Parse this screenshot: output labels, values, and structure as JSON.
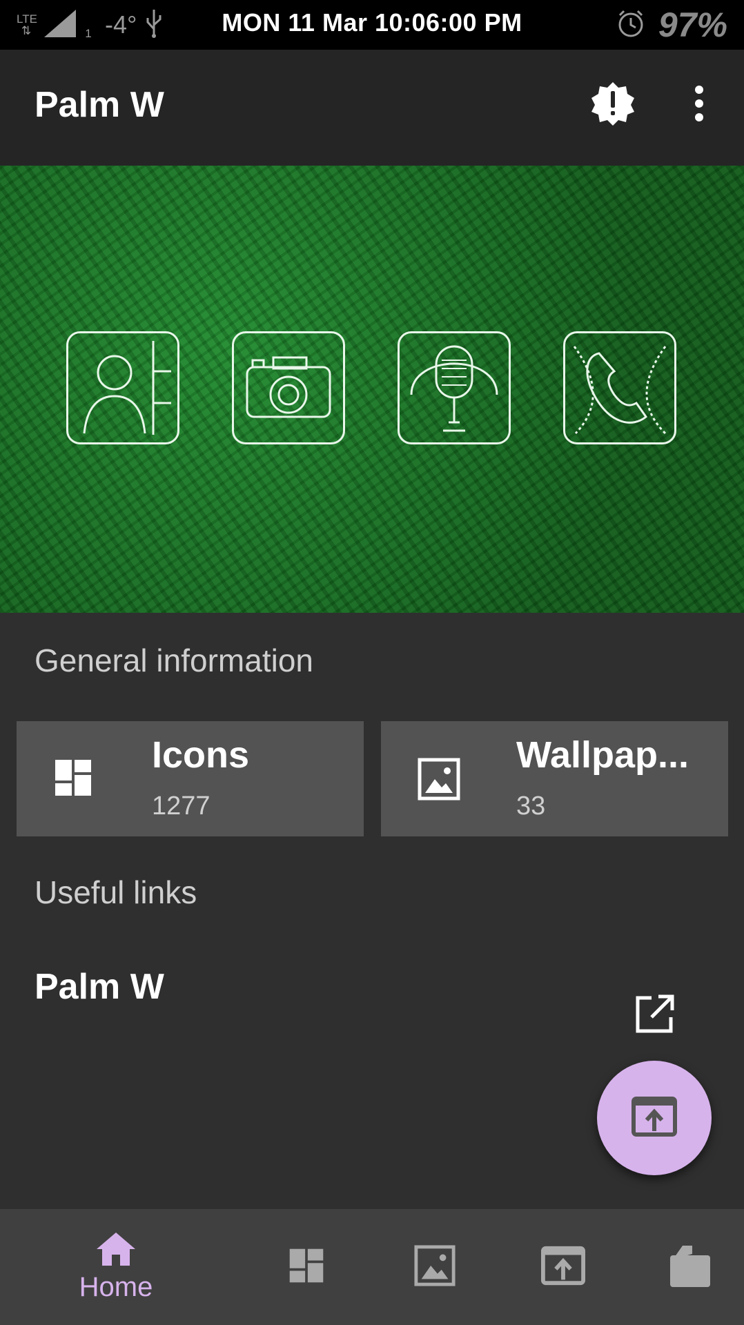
{
  "status_bar": {
    "network": "LTE",
    "sim": "1",
    "temperature": "-4°",
    "datetime": "MON 11 Mar 10:06:00 PM",
    "battery": "97%"
  },
  "app_bar": {
    "title": "Palm W"
  },
  "general_information": {
    "heading": "General information",
    "cards": [
      {
        "label": "Icons",
        "count": "1277",
        "icon": "dashboard-icon"
      },
      {
        "label": "Wallpap...",
        "count": "33",
        "icon": "wallpaper-icon"
      }
    ]
  },
  "useful_links": {
    "heading": "Useful links",
    "items": [
      {
        "label": "Palm W",
        "icon": "open-in-new-icon"
      }
    ]
  },
  "bottom_nav": {
    "items": [
      {
        "label": "Home",
        "icon": "home-icon",
        "selected": true
      },
      {
        "label": "",
        "icon": "dashboard-icon",
        "selected": false
      },
      {
        "label": "",
        "icon": "wallpaper-icon",
        "selected": false
      },
      {
        "label": "",
        "icon": "apply-icon",
        "selected": false
      },
      {
        "label": "",
        "icon": "request-icon",
        "selected": false
      }
    ]
  },
  "banner_icons": [
    "contacts-icon",
    "camera-icon",
    "microphone-icon",
    "phone-icon"
  ],
  "colors": {
    "accent": "#d7b3ec",
    "background": "#2f2f2f",
    "app_bar": "#252525",
    "card": "#535353",
    "bottom_nav": "#404040"
  }
}
